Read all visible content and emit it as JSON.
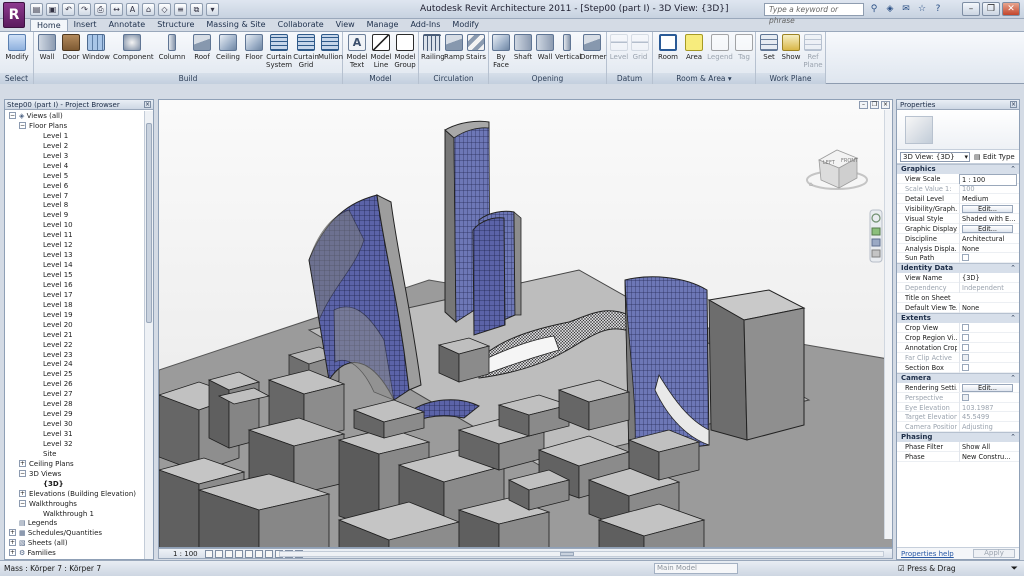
{
  "app": {
    "logo_letter": "R",
    "window_title": "Autodesk Revit Architecture 2011 - [Step00 (part I) - 3D View: {3D}]",
    "search_placeholder": "Type a keyword or phrase"
  },
  "ribbon_tabs": [
    "Home",
    "Insert",
    "Annotate",
    "Structure",
    "Massing & Site",
    "Collaborate",
    "View",
    "Manage",
    "Add-Ins",
    "Modify"
  ],
  "ribbon_groups": {
    "select": "Select",
    "build": "Build",
    "model": "Model",
    "circulation": "Circulation",
    "opening": "Opening",
    "datum": "Datum",
    "room_area": "Room & Area ▾",
    "work_plane": "Work Plane"
  },
  "tools": {
    "modify": "Modify",
    "wall": "Wall",
    "door": "Door",
    "window": "Window",
    "component": "Component",
    "column": "Column",
    "roof": "Roof",
    "ceiling": "Ceiling",
    "floor": "Floor",
    "curtain_system_1": "Curtain",
    "curtain_system_2": "System",
    "curtain_grid_1": "Curtain",
    "curtain_grid_2": "Grid",
    "mullion": "Mullion",
    "model_text_1": "Model",
    "model_text_2": "Text",
    "model_line_1": "Model",
    "model_line_2": "Line",
    "model_group_1": "Model",
    "model_group_2": "Group",
    "railing": "Railing",
    "ramp": "Ramp",
    "stairs": "Stairs",
    "by_face_1": "By",
    "by_face_2": "Face",
    "shaft": "Shaft",
    "op_wall": "Wall",
    "vertical": "Vertical",
    "dormer": "Dormer",
    "level": "Level",
    "grid": "Grid",
    "room": "Room",
    "area": "Area",
    "legend": "Legend",
    "tag": "Tag",
    "set": "Set",
    "show": "Show",
    "ref_plane_1": "Ref",
    "ref_plane_2": "Plane"
  },
  "project_browser": {
    "title": "Step00 (part I) - Project Browser",
    "views_all": "Views (all)",
    "floor_plans": "Floor Plans",
    "levels": [
      "Level 1",
      "Level 2",
      "Level 3",
      "Level 4",
      "Level 5",
      "Level 6",
      "Level 7",
      "Level 8",
      "Level 9",
      "Level 10",
      "Level 11",
      "Level 12",
      "Level 13",
      "Level 14",
      "Level 15",
      "Level 16",
      "Level 17",
      "Level 18",
      "Level 19",
      "Level 20",
      "Level 21",
      "Level 22",
      "Level 23",
      "Level 24",
      "Level 25",
      "Level 26",
      "Level 27",
      "Level 28",
      "Level 29",
      "Level 30",
      "Level 31",
      "Level 32"
    ],
    "site": "Site",
    "ceiling_plans": "Ceiling Plans",
    "views_3d": "3D Views",
    "view_3d_item": "{3D}",
    "elevations": "Elevations (Building Elevation)",
    "walkthroughs": "Walkthroughs",
    "walkthrough_1": "Walkthrough 1",
    "legends": "Legends",
    "schedules": "Schedules/Quantities",
    "sheets": "Sheets (all)",
    "families": "Families"
  },
  "viewport": {
    "scale": "1 : 100",
    "viewcube_top": "LEFT",
    "viewcube_front": "FRONT",
    "accent": "#3b4fa8"
  },
  "properties": {
    "title": "Properties",
    "type_selector": "3D View: {3D}",
    "edit_type": "Edit Type",
    "help_link": "Properties help",
    "apply": "Apply",
    "categories": {
      "graphics": "Graphics",
      "identity": "Identity Data",
      "extents": "Extents",
      "camera": "Camera",
      "phasing": "Phasing"
    },
    "edit_label": "Edit...",
    "graphics": {
      "view_scale_k": "View Scale",
      "view_scale_v": "1 : 100",
      "scale_value_k": "Scale Value  1:",
      "scale_value_v": "100",
      "detail_level_k": "Detail Level",
      "detail_level_v": "Medium",
      "visibility_k": "Visibility/Graph...",
      "visual_style_k": "Visual Style",
      "visual_style_v": "Shaded with E...",
      "graphic_display_k": "Graphic Display...",
      "discipline_k": "Discipline",
      "discipline_v": "Architectural",
      "analysis_k": "Analysis Displa...",
      "analysis_v": "None",
      "sun_path_k": "Sun Path"
    },
    "identity": {
      "view_name_k": "View Name",
      "view_name_v": "{3D}",
      "dependency_k": "Dependency",
      "dependency_v": "Independent",
      "title_on_sheet_k": "Title on Sheet",
      "default_view_k": "Default View Te...",
      "default_view_v": "None"
    },
    "extents": {
      "crop_view_k": "Crop View",
      "crop_region_k": "Crop Region Vi...",
      "annotation_crop_k": "Annotation Crop",
      "far_clip_k": "Far Clip Active",
      "section_box_k": "Section Box"
    },
    "camera": {
      "rendering_k": "Rendering Setti...",
      "perspective_k": "Perspective",
      "eye_elev_k": "Eye Elevation",
      "eye_elev_v": "103.1987",
      "target_elev_k": "Target Elevation",
      "target_elev_v": "45.5499",
      "camera_pos_k": "Camera Position",
      "camera_pos_v": "Adjusting"
    },
    "phasing": {
      "phase_filter_k": "Phase Filter",
      "phase_filter_v": "Show All",
      "phase_k": "Phase",
      "phase_v": "New Constru..."
    }
  },
  "status": {
    "text": "Mass : Körper 7 : Körper 7",
    "workset": "Main Model",
    "press_drag": "Press & Drag"
  }
}
